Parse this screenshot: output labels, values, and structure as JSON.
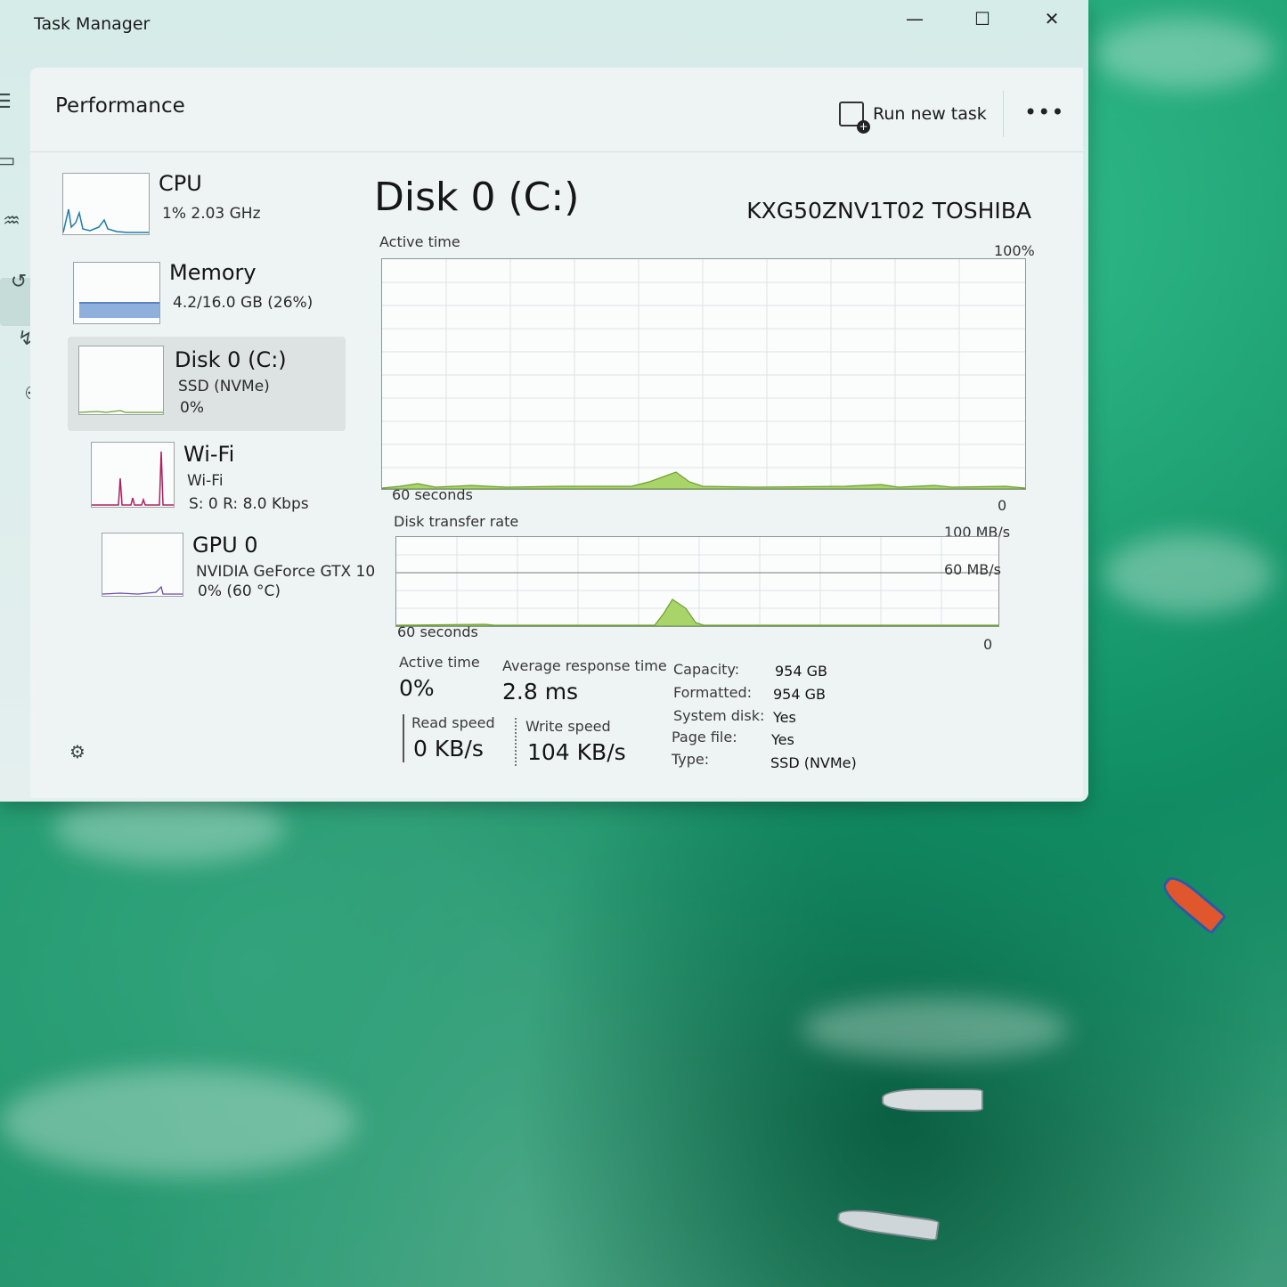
{
  "window": {
    "title": "Task Manager"
  },
  "header": {
    "page_title": "Performance",
    "run_task_label": "Run new task",
    "more_icon": "more-horizontal-icon"
  },
  "devices": [
    {
      "name": "CPU",
      "line1": "1%  2.03 GHz",
      "line2": ""
    },
    {
      "name": "Memory",
      "line1": "4.2/16.0 GB (26%)",
      "line2": ""
    },
    {
      "name": "Disk 0 (C:)",
      "line1": "SSD (NVMe)",
      "line2": "0%",
      "selected": true
    },
    {
      "name": "Wi-Fi",
      "line1": "Wi-Fi",
      "line2": "S: 0  R: 8.0 Kbps"
    },
    {
      "name": "GPU 0",
      "line1": "NVIDIA GeForce GTX 10",
      "line2": "0%  (60 °C)"
    }
  ],
  "disk": {
    "title": "Disk 0 (C:)",
    "model": "KXG50ZNV1T02 TOSHIBA",
    "active_graph": {
      "label": "Active time",
      "max": "100%",
      "min": "0",
      "time": "60 seconds"
    },
    "transfer_graph": {
      "label": "Disk transfer rate",
      "max": "100 MB/s",
      "mid": "60 MB/s",
      "min": "0",
      "time": "60 seconds"
    },
    "stats": {
      "active_time_label": "Active time",
      "active_time": "0%",
      "avg_resp_label": "Average response time",
      "avg_resp": "2.8 ms",
      "read_label": "Read speed",
      "read": "0 KB/s",
      "write_label": "Write speed",
      "write": "104 KB/s"
    },
    "props": [
      {
        "k": "Capacity:",
        "v": "954 GB"
      },
      {
        "k": "Formatted:",
        "v": "954 GB"
      },
      {
        "k": "System disk:",
        "v": "Yes"
      },
      {
        "k": "Page file:",
        "v": "Yes"
      },
      {
        "k": "Type:",
        "v": "SSD (NVMe)"
      }
    ]
  },
  "colors": {
    "disk_graph": "#8cc43c",
    "cpu_graph": "#1f7ca8",
    "memory_fill": "#8fb0dc",
    "wifi_graph": "#b02060",
    "gpu_graph": "#6a4aa8"
  }
}
